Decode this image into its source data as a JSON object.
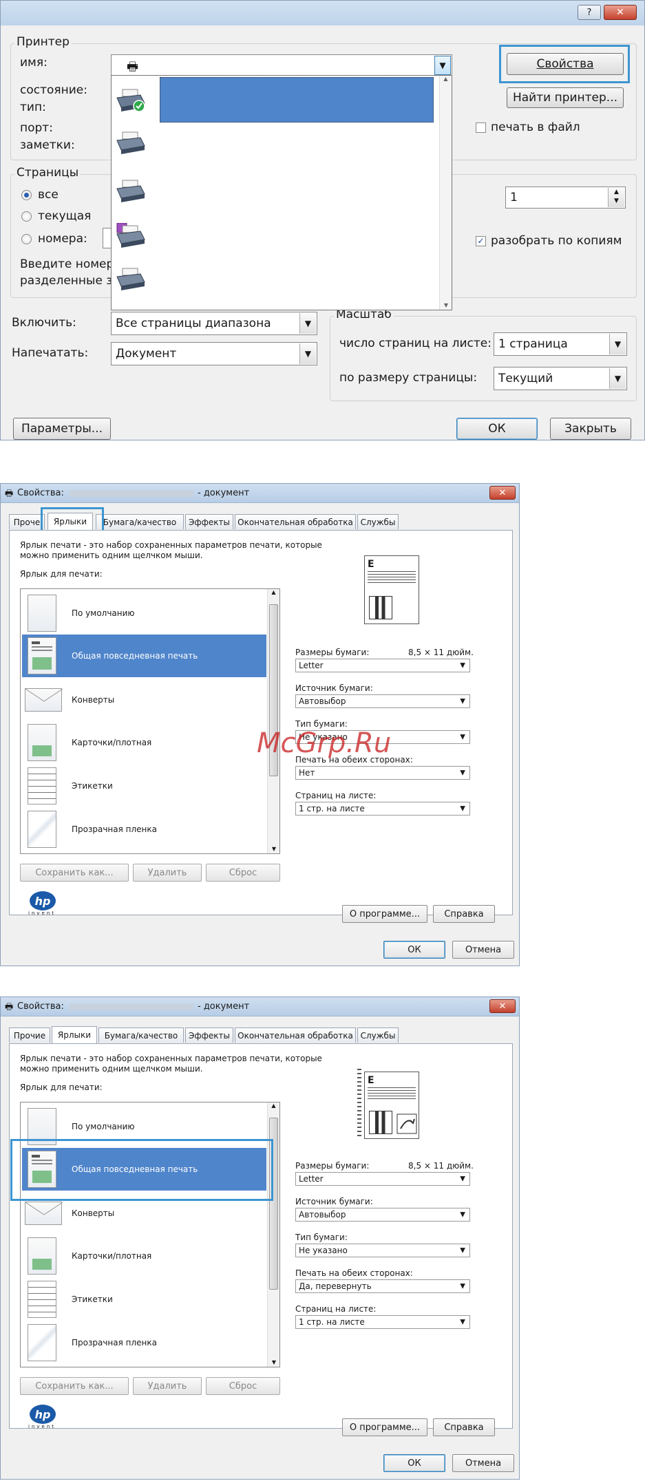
{
  "print_dialog": {
    "title_help": "?",
    "title_close": "✕",
    "printer_group": "Принтер",
    "labels": {
      "name": "имя:",
      "state": "состояние:",
      "type": "тип:",
      "port": "порт:",
      "comments": "заметки:"
    },
    "properties_button": "Свойства",
    "find_printer_button": "Найти принтер...",
    "print_to_file": "печать в файл",
    "print_to_file_checked": false,
    "pages_group": "Страницы",
    "radio_all": "все",
    "radio_current": "текущая",
    "radio_numbers": "номера:",
    "selected_range": "all",
    "hint_line1": "Введите номер",
    "hint_line2": "разделенные з",
    "copies_value": "1",
    "collate": "разобрать по копиям",
    "collate_checked": true,
    "include_label": "Включить:",
    "include_value": "Все страницы диапазона",
    "print_what_label": "Напечатать:",
    "print_what_value": "Документ",
    "scale_group": "Масштаб",
    "pages_per_sheet_label": "число страниц на листе:",
    "pages_per_sheet_value": "1 страница",
    "fit_to_label": "по размеру страницы:",
    "fit_to_value": "Текущий",
    "params_button": "Параметры...",
    "ok_button": "ОК",
    "close_button": "Закрыть",
    "printer_list_count": 6
  },
  "props_dialog_1": {
    "title_prefix": "Свойства:",
    "title_suffix": "- документ",
    "tabs": [
      "Проче",
      "Ярлыки",
      "Бумага/качество",
      "Эффекты",
      "Окончательная обработка",
      "Службы"
    ],
    "active_tab": "Ярлыки",
    "description_line1": "Ярлык печати - это набор сохраненных параметров печати, которые",
    "description_line2": "можно применить одним щелчком мыши.",
    "list_label": "Ярлык для печати:",
    "shortcuts": [
      "По умолчанию",
      "Общая повседневная печать",
      "Конверты",
      "Карточки/плотная",
      "Этикетки",
      "Прозрачная пленка"
    ],
    "selected_shortcut": "Общая повседневная печать",
    "paper_size_label": "Размеры бумаги:",
    "paper_size_dims": "8,5 × 11 дюйм.",
    "paper_size_value": "Letter",
    "paper_source_label": "Источник бумаги:",
    "paper_source_value": "Автовыбор",
    "paper_type_label": "Тип бумаги:",
    "paper_type_value": "Не указано",
    "duplex_label": "Печать на обеих сторонах:",
    "duplex_value": "Нет",
    "pages_per_sheet_label": "Страниц на листе:",
    "pages_per_sheet_value": "1 стр. на листе",
    "save_as_button": "Сохранить как...",
    "delete_button": "Удалить",
    "reset_button": "Сброс",
    "about_button": "О программе...",
    "help_button": "Справка",
    "ok_button": "ОК",
    "cancel_button": "Отмена",
    "logo_text": "hp",
    "logo_sub": "invent",
    "close_x": "✕"
  },
  "props_dialog_2": {
    "title_prefix": "Свойства:",
    "title_suffix": "- документ",
    "tabs": [
      "Прочие",
      "Ярлыки",
      "Бумага/качество",
      "Эффекты",
      "Окончательная обработка",
      "Службы"
    ],
    "active_tab": "Ярлыки",
    "description_line1": "Ярлык печати - это набор сохраненных параметров печати, которые",
    "description_line2": "можно применить одним щелчком мыши.",
    "list_label": "Ярлык для печати:",
    "shortcuts": [
      "По умолчанию",
      "Общая повседневная печать",
      "Конверты",
      "Карточки/плотная",
      "Этикетки",
      "Прозрачная пленка"
    ],
    "selected_shortcut": "Общая повседневная печать",
    "paper_size_label": "Размеры бумаги:",
    "paper_size_dims": "8,5 × 11 дюйм.",
    "paper_size_value": "Letter",
    "paper_source_label": "Источник бумаги:",
    "paper_source_value": "Автовыбор",
    "paper_type_label": "Тип бумаги:",
    "paper_type_value": "Не указано",
    "duplex_label": "Печать на обеих сторонах:",
    "duplex_value": "Да, перевернуть",
    "pages_per_sheet_label": "Страниц на листе:",
    "pages_per_sheet_value": "1 стр. на листе",
    "save_as_button": "Сохранить как...",
    "delete_button": "Удалить",
    "reset_button": "Сброс",
    "about_button": "О программе...",
    "help_button": "Справка",
    "ok_button": "ОК",
    "cancel_button": "Отмена",
    "logo_text": "hp",
    "logo_sub": "invent",
    "close_x": "✕"
  },
  "watermark": "McGrp.Ru",
  "colors": {
    "highlight_outline": "#3d95d0",
    "selection_blue": "#4f85cb",
    "dialog_bg": "#f0f0f0",
    "close_red": "#c4412c"
  }
}
